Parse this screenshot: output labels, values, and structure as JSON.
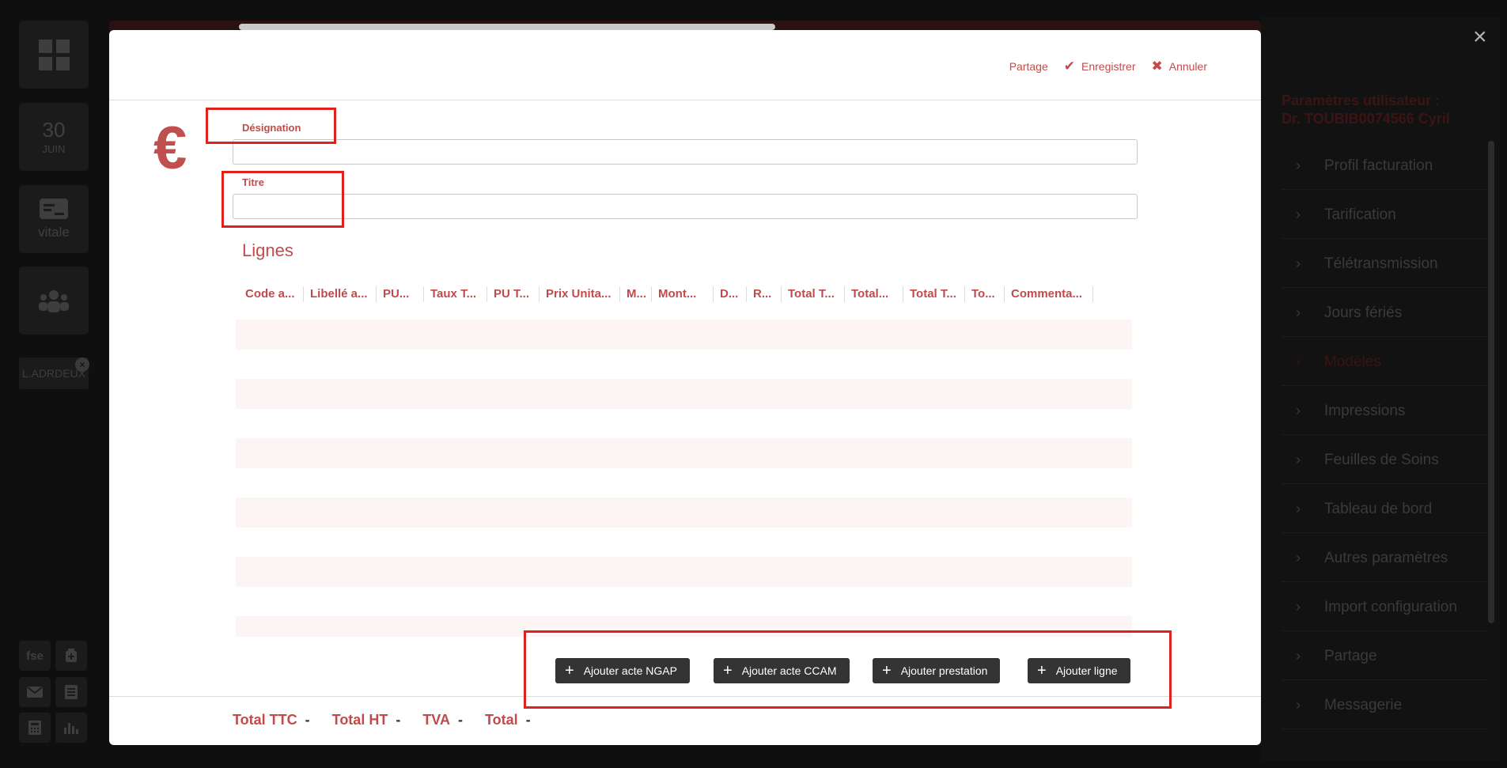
{
  "rail": {
    "date_day": "30",
    "date_month": "JUIN",
    "vitale_label": "vitale",
    "folder_label": "L.ADRDEUX",
    "folder_close": "×",
    "fse_label": "fse"
  },
  "right_panel": {
    "title_line1": "Paramètres utilisateur :",
    "title_line2": "Dr. TOUBIB0074566 Cyril",
    "close": "×",
    "items": [
      {
        "label": "Profil facturation"
      },
      {
        "label": "Tarification"
      },
      {
        "label": "Télétransmission"
      },
      {
        "label": "Jours fériés"
      },
      {
        "label": "Modèles"
      },
      {
        "label": "Impressions"
      },
      {
        "label": "Feuilles de Soins"
      },
      {
        "label": "Tableau de bord"
      },
      {
        "label": "Autres paramètres"
      },
      {
        "label": "Import configuration"
      },
      {
        "label": "Partage"
      },
      {
        "label": "Messagerie"
      }
    ],
    "active_item": "Modèles",
    "chevron": "›"
  },
  "modal": {
    "actions": {
      "partage": "Partage",
      "enregistrer": "Enregistrer",
      "annuler": "Annuler",
      "check_glyph": "✔",
      "cross_glyph": "✖"
    },
    "currency_symbol": "€",
    "designation_label": "Désignation",
    "titre_label": "Titre",
    "lignes_title": "Lignes",
    "columns": [
      "Code a...",
      "Libellé a...",
      "PU...",
      "Taux T...",
      "PU T...",
      "Prix Unita...",
      "M...",
      "Mont...",
      "D...",
      "R...",
      "Total T...",
      "Total...",
      "Total T...",
      "To...",
      "Commenta..."
    ],
    "buttons": {
      "plus": "+",
      "ngap": "Ajouter acte NGAP",
      "ccam": "Ajouter acte CCAM",
      "prestation": "Ajouter prestation",
      "ligne": "Ajouter ligne"
    },
    "totals": {
      "ttc_label": "Total TTC",
      "ttc_value": "-",
      "ht_label": "Total HT",
      "ht_value": "-",
      "tva_label": "TVA",
      "tva_value": "-",
      "total_label": "Total",
      "total_value": "-"
    }
  }
}
